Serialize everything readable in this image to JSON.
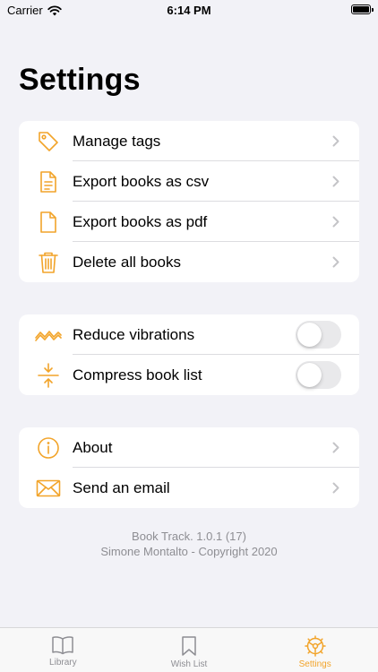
{
  "status_bar": {
    "carrier": "Carrier",
    "time": "6:14 PM"
  },
  "page": {
    "title": "Settings"
  },
  "groups": {
    "data": {
      "items": [
        {
          "label": "Manage tags",
          "icon": "tag-icon"
        },
        {
          "label": "Export books as csv",
          "icon": "document-text-icon"
        },
        {
          "label": "Export books as pdf",
          "icon": "document-icon"
        },
        {
          "label": "Delete all books",
          "icon": "trash-icon"
        }
      ]
    },
    "prefs": {
      "items": [
        {
          "label": "Reduce vibrations",
          "icon": "vibration-icon",
          "enabled": false
        },
        {
          "label": "Compress book list",
          "icon": "compress-icon",
          "enabled": false
        }
      ]
    },
    "info": {
      "items": [
        {
          "label": "About",
          "icon": "info-icon"
        },
        {
          "label": "Send an email",
          "icon": "envelope-icon"
        }
      ]
    }
  },
  "footer": {
    "version": "Book Track. 1.0.1 (17)",
    "copyright": "Simone Montalto - Copyright 2020"
  },
  "tabbar": {
    "tabs": [
      {
        "label": "Library",
        "icon": "book-icon",
        "active": false
      },
      {
        "label": "Wish List",
        "icon": "bookmark-icon",
        "active": false
      },
      {
        "label": "Settings",
        "icon": "gear-icon",
        "active": true
      }
    ]
  },
  "colors": {
    "accent": "#f2a42a",
    "background": "#f2f2f7",
    "secondary_text": "#8e8e93",
    "chevron": "#c4c4c7"
  }
}
